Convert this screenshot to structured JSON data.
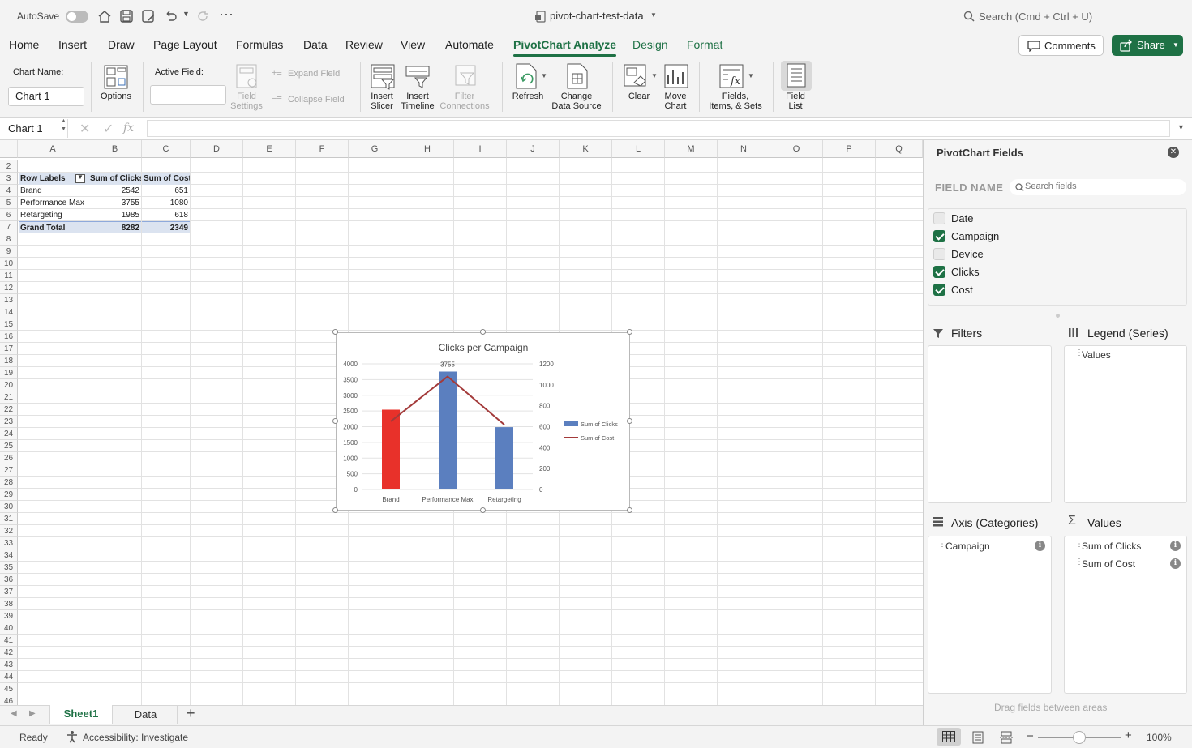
{
  "titlebar": {
    "autosave_label": "AutoSave",
    "file_name": "pivot-chart-test-data",
    "search_placeholder": "Search (Cmd + Ctrl + U)"
  },
  "ribbon_tabs": [
    "Home",
    "Insert",
    "Draw",
    "Page Layout",
    "Formulas",
    "Data",
    "Review",
    "View",
    "Automate",
    "PivotChart Analyze",
    "Design",
    "Format"
  ],
  "active_tab": "PivotChart Analyze",
  "buttons": {
    "comments": "Comments",
    "share": "Share"
  },
  "ribbon": {
    "chart_name_label": "Chart Name:",
    "chart_name_value": "Chart 1",
    "options": "Options",
    "active_field_label": "Active Field:",
    "active_field_value": "",
    "field_settings": [
      "Field",
      "Settings"
    ],
    "expand_field": "Expand Field",
    "collapse_field": "Collapse Field",
    "insert_slicer": [
      "Insert",
      "Slicer"
    ],
    "insert_timeline": [
      "Insert",
      "Timeline"
    ],
    "filter_connections": [
      "Filter",
      "Connections"
    ],
    "refresh": "Refresh",
    "change_data_source": [
      "Change",
      "Data Source"
    ],
    "clear": "Clear",
    "move_chart": [
      "Move",
      "Chart"
    ],
    "fields_items_sets": [
      "Fields,",
      "Items, & Sets"
    ],
    "field_list": [
      "Field",
      "List"
    ]
  },
  "formula_bar": {
    "name_box": "Chart 1",
    "fx": "fx",
    "formula": ""
  },
  "grid": {
    "columns": [
      "A",
      "B",
      "C",
      "D",
      "E",
      "F",
      "G",
      "H",
      "I",
      "J",
      "K",
      "L",
      "M",
      "N",
      "O",
      "P",
      "Q"
    ],
    "first_row": 2,
    "last_row": 46,
    "pivot": {
      "headers": [
        "Row Labels",
        "Sum of Clicks",
        "Sum of Cost"
      ],
      "rows": [
        {
          "label": "Brand",
          "clicks": "2542",
          "cost": "651"
        },
        {
          "label": "Performance Max",
          "clicks": "3755",
          "cost": "1080"
        },
        {
          "label": "Retargeting",
          "clicks": "1985",
          "cost": "618"
        }
      ],
      "total": {
        "label": "Grand Total",
        "clicks": "8282",
        "cost": "2349"
      }
    }
  },
  "chart_data": {
    "type": "bar",
    "title": "Clicks per Campaign",
    "categories": [
      "Brand",
      "Performance Max",
      "Retargeting"
    ],
    "series": [
      {
        "name": "Sum of Clicks",
        "kind": "bar",
        "axis": "primary",
        "values": [
          2542,
          3755,
          1985
        ]
      },
      {
        "name": "Sum of Cost",
        "kind": "line",
        "axis": "secondary",
        "values": [
          651,
          1080,
          618
        ]
      }
    ],
    "colors": {
      "bar_default": "#5b7fbf",
      "bar_highlight": "#e8312a",
      "line": "#a33a3a"
    },
    "highlighted_category": "Brand",
    "data_label": {
      "category": "Performance Max",
      "text": "3755"
    },
    "ylim": [
      0,
      4000
    ],
    "yticks": [
      "0",
      "500",
      "1000",
      "1500",
      "2000",
      "2500",
      "3000",
      "3500",
      "4000"
    ],
    "y2lim": [
      0,
      1200
    ],
    "y2ticks": [
      "0",
      "200",
      "400",
      "600",
      "800",
      "1000",
      "1200"
    ],
    "legend_position": "right",
    "grid": true
  },
  "pane": {
    "title": "PivotChart Fields",
    "field_name_label": "FIELD NAME",
    "search_placeholder": "Search fields",
    "fields": [
      {
        "name": "Date",
        "checked": false
      },
      {
        "name": "Campaign",
        "checked": true
      },
      {
        "name": "Device",
        "checked": false
      },
      {
        "name": "Clicks",
        "checked": true
      },
      {
        "name": "Cost",
        "checked": true
      }
    ],
    "filters_label": "Filters",
    "legend_label": "Legend (Series)",
    "legend_items": [
      "Values"
    ],
    "axis_label": "Axis (Categories)",
    "axis_items": [
      "Campaign"
    ],
    "values_label": "Values",
    "values_items": [
      "Sum of Clicks",
      "Sum of Cost"
    ],
    "footer": "Drag fields between areas"
  },
  "sheet_tabs": [
    "Sheet1",
    "Data"
  ],
  "active_sheet": "Sheet1",
  "status": {
    "ready": "Ready",
    "accessibility": "Accessibility: Investigate",
    "zoom": "100%"
  }
}
